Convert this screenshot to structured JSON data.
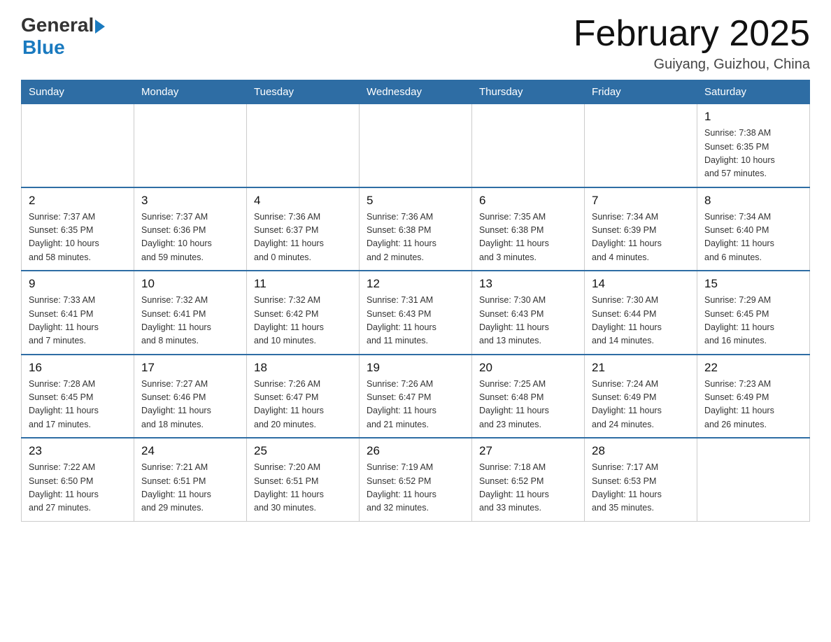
{
  "header": {
    "logo_general": "General",
    "logo_blue": "Blue",
    "month_title": "February 2025",
    "location": "Guiyang, Guizhou, China"
  },
  "days_of_week": [
    "Sunday",
    "Monday",
    "Tuesday",
    "Wednesday",
    "Thursday",
    "Friday",
    "Saturday"
  ],
  "weeks": [
    [
      {
        "day": "",
        "info": ""
      },
      {
        "day": "",
        "info": ""
      },
      {
        "day": "",
        "info": ""
      },
      {
        "day": "",
        "info": ""
      },
      {
        "day": "",
        "info": ""
      },
      {
        "day": "",
        "info": ""
      },
      {
        "day": "1",
        "info": "Sunrise: 7:38 AM\nSunset: 6:35 PM\nDaylight: 10 hours\nand 57 minutes."
      }
    ],
    [
      {
        "day": "2",
        "info": "Sunrise: 7:37 AM\nSunset: 6:35 PM\nDaylight: 10 hours\nand 58 minutes."
      },
      {
        "day": "3",
        "info": "Sunrise: 7:37 AM\nSunset: 6:36 PM\nDaylight: 10 hours\nand 59 minutes."
      },
      {
        "day": "4",
        "info": "Sunrise: 7:36 AM\nSunset: 6:37 PM\nDaylight: 11 hours\nand 0 minutes."
      },
      {
        "day": "5",
        "info": "Sunrise: 7:36 AM\nSunset: 6:38 PM\nDaylight: 11 hours\nand 2 minutes."
      },
      {
        "day": "6",
        "info": "Sunrise: 7:35 AM\nSunset: 6:38 PM\nDaylight: 11 hours\nand 3 minutes."
      },
      {
        "day": "7",
        "info": "Sunrise: 7:34 AM\nSunset: 6:39 PM\nDaylight: 11 hours\nand 4 minutes."
      },
      {
        "day": "8",
        "info": "Sunrise: 7:34 AM\nSunset: 6:40 PM\nDaylight: 11 hours\nand 6 minutes."
      }
    ],
    [
      {
        "day": "9",
        "info": "Sunrise: 7:33 AM\nSunset: 6:41 PM\nDaylight: 11 hours\nand 7 minutes."
      },
      {
        "day": "10",
        "info": "Sunrise: 7:32 AM\nSunset: 6:41 PM\nDaylight: 11 hours\nand 8 minutes."
      },
      {
        "day": "11",
        "info": "Sunrise: 7:32 AM\nSunset: 6:42 PM\nDaylight: 11 hours\nand 10 minutes."
      },
      {
        "day": "12",
        "info": "Sunrise: 7:31 AM\nSunset: 6:43 PM\nDaylight: 11 hours\nand 11 minutes."
      },
      {
        "day": "13",
        "info": "Sunrise: 7:30 AM\nSunset: 6:43 PM\nDaylight: 11 hours\nand 13 minutes."
      },
      {
        "day": "14",
        "info": "Sunrise: 7:30 AM\nSunset: 6:44 PM\nDaylight: 11 hours\nand 14 minutes."
      },
      {
        "day": "15",
        "info": "Sunrise: 7:29 AM\nSunset: 6:45 PM\nDaylight: 11 hours\nand 16 minutes."
      }
    ],
    [
      {
        "day": "16",
        "info": "Sunrise: 7:28 AM\nSunset: 6:45 PM\nDaylight: 11 hours\nand 17 minutes."
      },
      {
        "day": "17",
        "info": "Sunrise: 7:27 AM\nSunset: 6:46 PM\nDaylight: 11 hours\nand 18 minutes."
      },
      {
        "day": "18",
        "info": "Sunrise: 7:26 AM\nSunset: 6:47 PM\nDaylight: 11 hours\nand 20 minutes."
      },
      {
        "day": "19",
        "info": "Sunrise: 7:26 AM\nSunset: 6:47 PM\nDaylight: 11 hours\nand 21 minutes."
      },
      {
        "day": "20",
        "info": "Sunrise: 7:25 AM\nSunset: 6:48 PM\nDaylight: 11 hours\nand 23 minutes."
      },
      {
        "day": "21",
        "info": "Sunrise: 7:24 AM\nSunset: 6:49 PM\nDaylight: 11 hours\nand 24 minutes."
      },
      {
        "day": "22",
        "info": "Sunrise: 7:23 AM\nSunset: 6:49 PM\nDaylight: 11 hours\nand 26 minutes."
      }
    ],
    [
      {
        "day": "23",
        "info": "Sunrise: 7:22 AM\nSunset: 6:50 PM\nDaylight: 11 hours\nand 27 minutes."
      },
      {
        "day": "24",
        "info": "Sunrise: 7:21 AM\nSunset: 6:51 PM\nDaylight: 11 hours\nand 29 minutes."
      },
      {
        "day": "25",
        "info": "Sunrise: 7:20 AM\nSunset: 6:51 PM\nDaylight: 11 hours\nand 30 minutes."
      },
      {
        "day": "26",
        "info": "Sunrise: 7:19 AM\nSunset: 6:52 PM\nDaylight: 11 hours\nand 32 minutes."
      },
      {
        "day": "27",
        "info": "Sunrise: 7:18 AM\nSunset: 6:52 PM\nDaylight: 11 hours\nand 33 minutes."
      },
      {
        "day": "28",
        "info": "Sunrise: 7:17 AM\nSunset: 6:53 PM\nDaylight: 11 hours\nand 35 minutes."
      },
      {
        "day": "",
        "info": ""
      }
    ]
  ]
}
